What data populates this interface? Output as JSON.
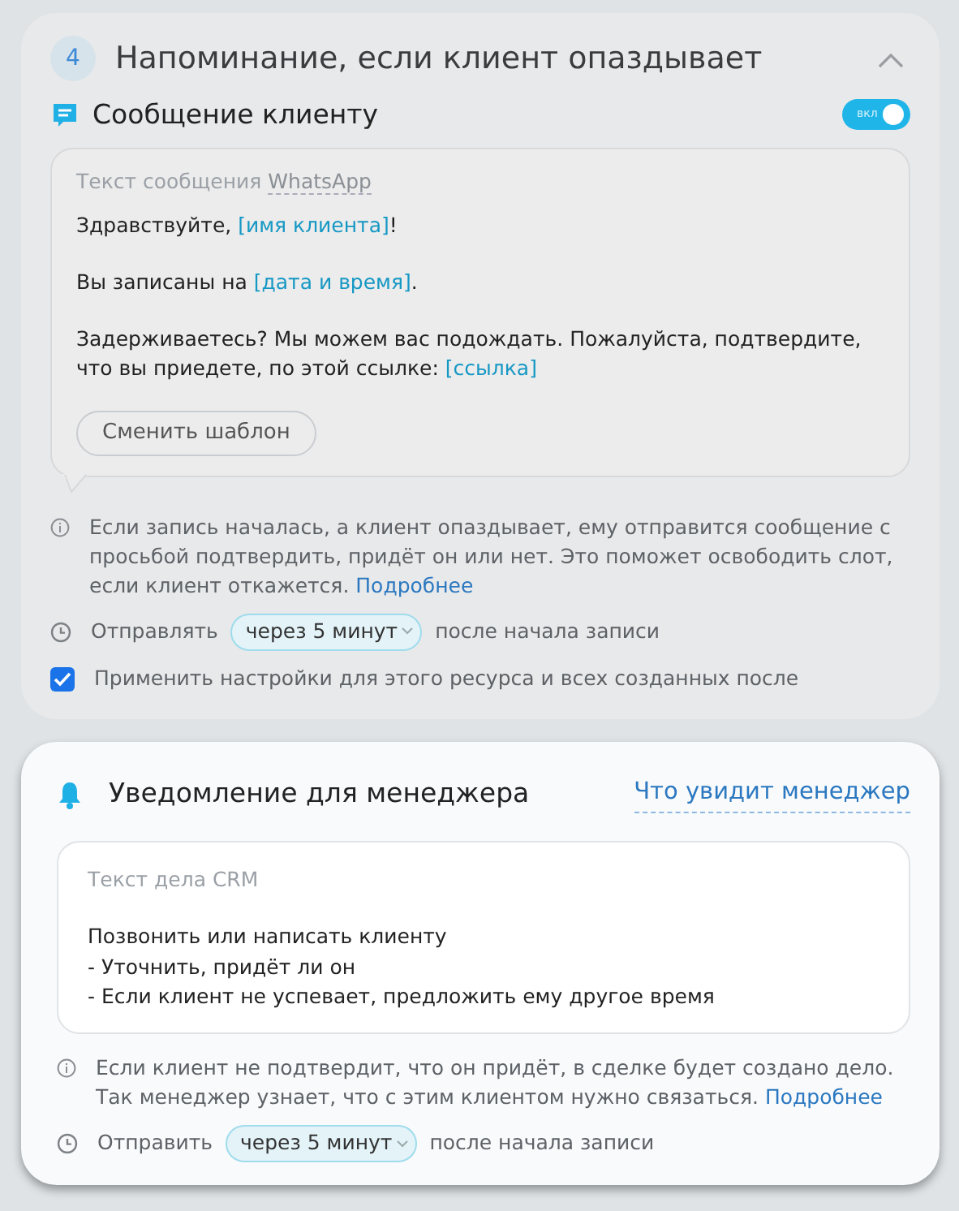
{
  "step": {
    "number": "4",
    "title": "Напоминание, если клиент опаздывает",
    "expanded": true
  },
  "client_message": {
    "title": "Сообщение клиенту",
    "toggle": {
      "label": "вкл",
      "on": true
    },
    "template_label": "Текст сообщения",
    "template_channel": "WhatsApp",
    "paragraphs": [
      [
        {
          "kind": "text",
          "text": "Здравствуйте, "
        },
        {
          "kind": "variable",
          "text": "[имя клиента]"
        },
        {
          "kind": "text",
          "text": "!"
        }
      ],
      [
        {
          "kind": "text",
          "text": "Вы записаны на "
        },
        {
          "kind": "variable",
          "text": "[дата и время]"
        },
        {
          "kind": "text",
          "text": "."
        }
      ],
      [
        {
          "kind": "text",
          "text": "Задерживаетесь? Мы можем вас подождать. Пожалуйста, подтвердите, что вы приедете, по этой ссылке: "
        },
        {
          "kind": "variable",
          "text": "[ссылка]"
        }
      ]
    ],
    "change_button": "Сменить шаблон",
    "info": {
      "text": "Если запись началась, а клиент опаздывает, ему отправится сообщение с просьбой подтвердить, придёт он или нет. Это поможет освободить слот, если клиент откажется.",
      "link": "Подробнее"
    },
    "schedule": {
      "prefix": "Отправлять",
      "value": "через 5 минут",
      "suffix": "после начала записи"
    },
    "apply_all": {
      "label": "Применить настройки для этого ресурса и всех созданных после",
      "checked": true
    }
  },
  "manager_notice": {
    "title": "Уведомление для менеджера",
    "preview_link": "Что увидит менеджер",
    "task_label": "Текст дела CRM",
    "task_lines": [
      "Позвонить или написать клиенту",
      "- Уточнить, придёт ли он",
      "- Если клиент не успевает, предложить ему другое время"
    ],
    "info": {
      "text": "Если клиент не подтвердит, что он придёт, в сделке будет создано дело. Так менеджер узнает, что с этим клиентом нужно связаться.",
      "link": "Подробнее"
    },
    "schedule": {
      "prefix": "Отправить",
      "value": "через 5 минут",
      "suffix": "после начала записи"
    }
  }
}
